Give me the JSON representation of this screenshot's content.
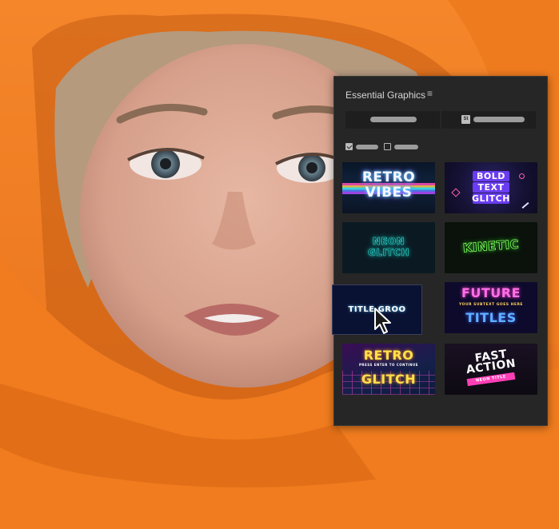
{
  "panel": {
    "title": "Essential Graphics",
    "menu_icon": "hamburger-menu-icon",
    "tabs": [
      {
        "name": "browse",
        "icon": null
      },
      {
        "name": "stock",
        "icon": "adobe-stock-icon",
        "badge": "St"
      }
    ],
    "filters": [
      {
        "name": "filter-a",
        "checked": true
      },
      {
        "name": "filter-b",
        "checked": false
      }
    ]
  },
  "templates": [
    {
      "lines": [
        "RETRO",
        "VIBES"
      ]
    },
    {
      "lines": [
        "BOLD",
        "TEXT",
        "GLITCH"
      ]
    },
    {
      "lines": [
        "NEON",
        "GLITCH"
      ]
    },
    {
      "lines": [
        "KINETIC"
      ]
    },
    {
      "lines": [
        "TITLE GROO"
      ],
      "selected": true
    },
    {
      "lines": [
        "FUTURE",
        "TITLES"
      ],
      "subtitle": "YOUR SUBTEXT GOES HERE"
    },
    {
      "lines": [
        "RETRO",
        "GLITCH"
      ],
      "subtitle": "PRESS ENTER TO CONTINUE"
    },
    {
      "lines": [
        "FAST",
        "ACTION"
      ],
      "subtitle": "NEON TITLE"
    }
  ],
  "cursor_icon": "mouse-pointer-icon",
  "colors": {
    "panel_bg": "#262626",
    "hoodie_orange": "#f07c1f"
  }
}
